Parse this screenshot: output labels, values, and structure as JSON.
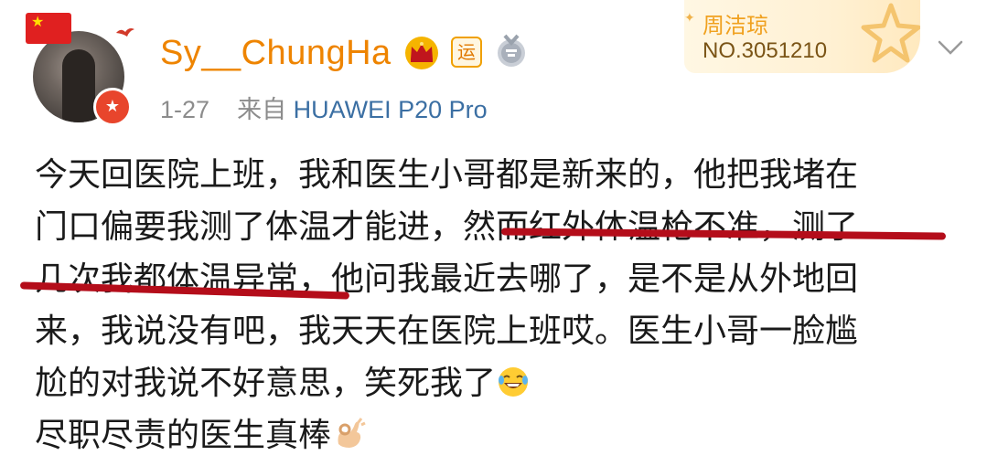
{
  "user": {
    "name": "Sy__ChungHa",
    "avatar_badge_glyph": "★",
    "badge_yun": "运"
  },
  "meta": {
    "date": "1-27",
    "source_prefix": "来自",
    "device": "HUAWEI P20 Pro"
  },
  "fan_card": {
    "name": "周洁琼",
    "number": "NO.3051210"
  },
  "post": {
    "lines": [
      "今天回医院上班，我和医生小哥都是新来的，他把我堵在",
      "门口偏要我测了体温才能进，然而红外体温枪不准，测了",
      "几次我都体温异常，他问我最近去哪了，是不是从外地回",
      "来，我说没有吧，我天天在医院上班哎。医生小哥一脸尴",
      "尬的对我说不好意思，笑死我了",
      "尽职尽责的医生真棒"
    ],
    "emoji_line5": "laughing-tears-emoji",
    "emoji_line6": "ok-hand-emoji"
  },
  "colors": {
    "username": "#ee8400",
    "device": "#3b6fa3",
    "meta": "#8c8c8c",
    "underline": "#b40d1a"
  }
}
